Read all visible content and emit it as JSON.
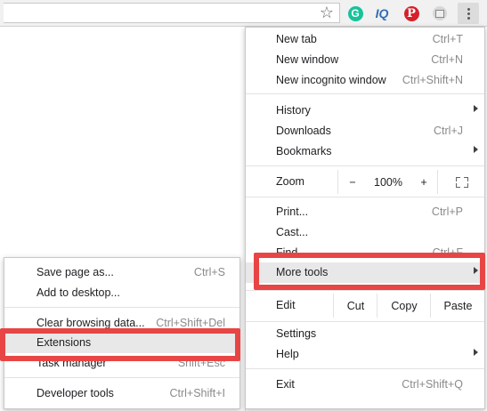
{
  "toolbar": {
    "icons": [
      "star-icon",
      "grammarly-icon",
      "iq-icon",
      "pinterest-icon",
      "extension-icon",
      "menu-icon"
    ],
    "grammarly_letter": "G",
    "iq_text": "IQ",
    "pinterest_letter": "P"
  },
  "main_menu": {
    "new_tab": {
      "label": "New tab",
      "shortcut": "Ctrl+T"
    },
    "new_window": {
      "label": "New window",
      "shortcut": "Ctrl+N"
    },
    "new_incognito": {
      "label": "New incognito window",
      "shortcut": "Ctrl+Shift+N"
    },
    "history": {
      "label": "History"
    },
    "downloads": {
      "label": "Downloads",
      "shortcut": "Ctrl+J"
    },
    "bookmarks": {
      "label": "Bookmarks"
    },
    "zoom": {
      "label": "Zoom",
      "minus": "−",
      "value": "100%",
      "plus": "+"
    },
    "print": {
      "label": "Print...",
      "shortcut": "Ctrl+P"
    },
    "cast": {
      "label": "Cast..."
    },
    "find": {
      "label": "Find...",
      "shortcut": "Ctrl+F"
    },
    "more_tools": {
      "label": "More tools"
    },
    "edit": {
      "label": "Edit",
      "cut": "Cut",
      "copy": "Copy",
      "paste": "Paste"
    },
    "settings": {
      "label": "Settings"
    },
    "help": {
      "label": "Help"
    },
    "exit": {
      "label": "Exit",
      "shortcut": "Ctrl+Shift+Q"
    }
  },
  "sub_menu": {
    "save_page": {
      "label": "Save page as...",
      "shortcut": "Ctrl+S"
    },
    "add_desktop": {
      "label": "Add to desktop..."
    },
    "clear_browsing": {
      "label": "Clear browsing data...",
      "shortcut": "Ctrl+Shift+Del"
    },
    "extensions": {
      "label": "Extensions"
    },
    "task_manager": {
      "label": "Task manager",
      "shortcut": "Shift+Esc"
    },
    "developer_tools": {
      "label": "Developer tools",
      "shortcut": "Ctrl+Shift+I"
    }
  },
  "colors": {
    "highlight": "#e84545",
    "grammarly": "#15c39a",
    "pinterest": "#d5202b",
    "iq": "#2f6db5"
  }
}
